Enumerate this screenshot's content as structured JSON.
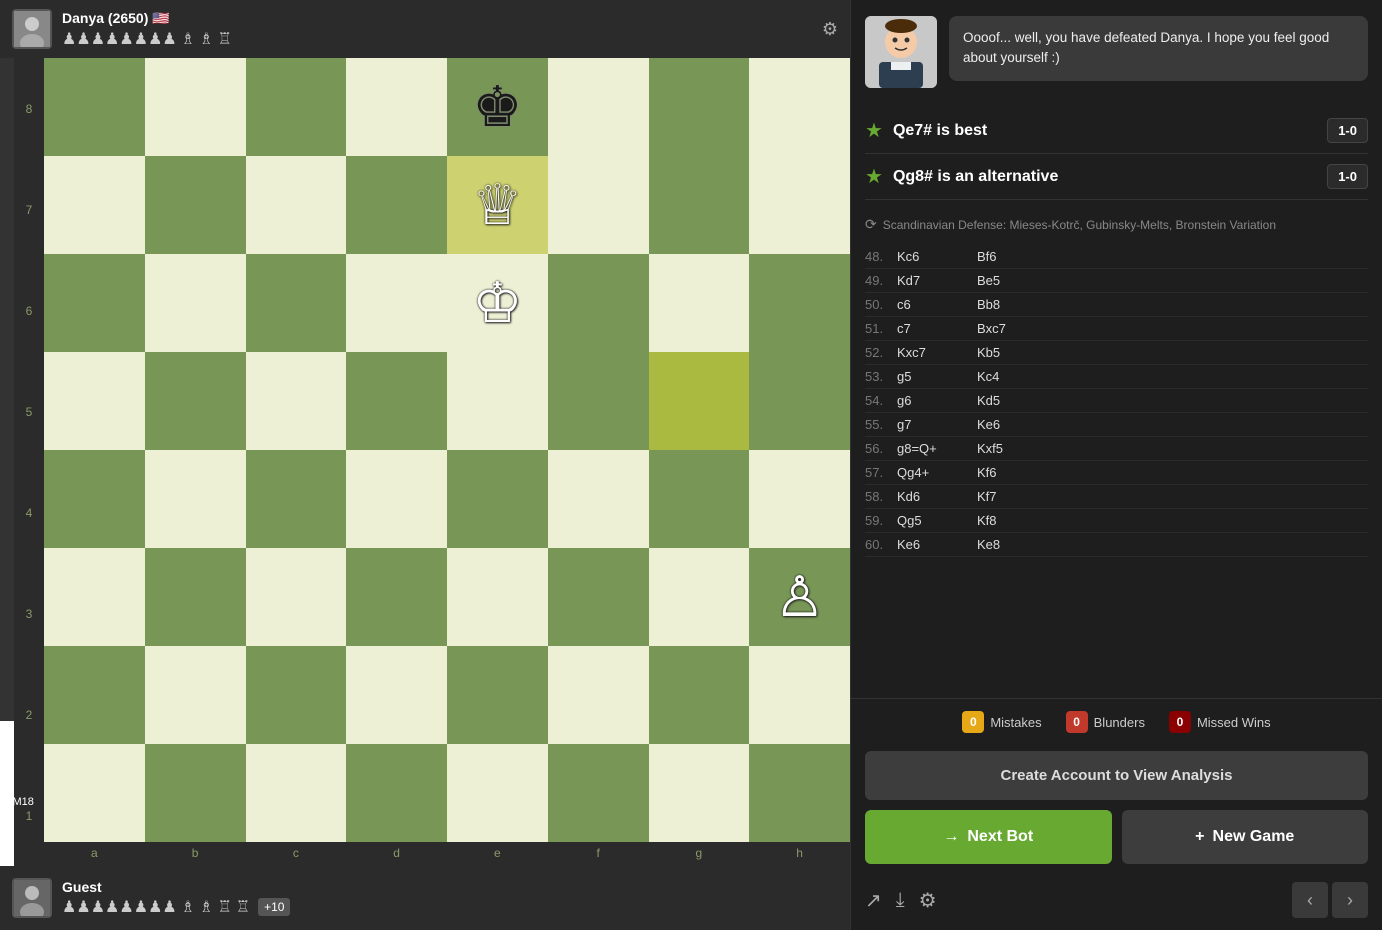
{
  "top_player": {
    "name": "Danya (2650)",
    "flag": "🇺🇸",
    "pieces": "♟♟♟♟♟♟♟♟ ♗ ♗ ♖"
  },
  "bottom_player": {
    "name": "Guest",
    "pieces": "♟♟♟♟♟♟♟♟ ♗ ♗ ♖ ♖",
    "score": "+10"
  },
  "eval": "+M18",
  "chat": {
    "message": "Oooof... well, you have defeated Danya. I hope you feel good about yourself :)"
  },
  "best_moves": [
    {
      "move": "Qe7# is best",
      "score": "1-0"
    },
    {
      "move": "Qg8# is an alternative",
      "score": "1-0"
    }
  ],
  "opening": "Scandinavian Defense: Mieses-Kotrč, Gubinsky-Melts, Bronstein Variation",
  "moves": [
    {
      "num": "48.",
      "white": "Kc6",
      "black": "Bf6"
    },
    {
      "num": "49.",
      "white": "Kd7",
      "black": "Be5"
    },
    {
      "num": "50.",
      "white": "c6",
      "black": "Bb8"
    },
    {
      "num": "51.",
      "white": "c7",
      "black": "Bxc7"
    },
    {
      "num": "52.",
      "white": "Kxc7",
      "black": "Kb5"
    },
    {
      "num": "53.",
      "white": "g5",
      "black": "Kc4"
    },
    {
      "num": "54.",
      "white": "g6",
      "black": "Kd5"
    },
    {
      "num": "55.",
      "white": "g7",
      "black": "Ke6"
    },
    {
      "num": "56.",
      "white": "g8=Q+",
      "black": "Kxf5"
    },
    {
      "num": "57.",
      "white": "Qg4+",
      "black": "Kf6"
    },
    {
      "num": "58.",
      "white": "Kd6",
      "black": "Kf7"
    },
    {
      "num": "59.",
      "white": "Qg5",
      "black": "Kf8"
    },
    {
      "num": "60.",
      "white": "Ke6",
      "black": "Ke8"
    }
  ],
  "stats": {
    "mistakes": "0",
    "mistakes_label": "Mistakes",
    "blunders": "0",
    "blunders_label": "Blunders",
    "missed_wins": "0",
    "missed_wins_label": "Missed Wins"
  },
  "create_account_label": "Create Account to View Analysis",
  "buttons": {
    "next_bot": "Next Bot",
    "new_game": "New Game"
  },
  "board_labels": {
    "rows": [
      "8",
      "7",
      "6",
      "5",
      "4",
      "3",
      "2",
      "1"
    ],
    "cols": [
      "a",
      "b",
      "c",
      "d",
      "e",
      "f",
      "g",
      "h"
    ]
  }
}
